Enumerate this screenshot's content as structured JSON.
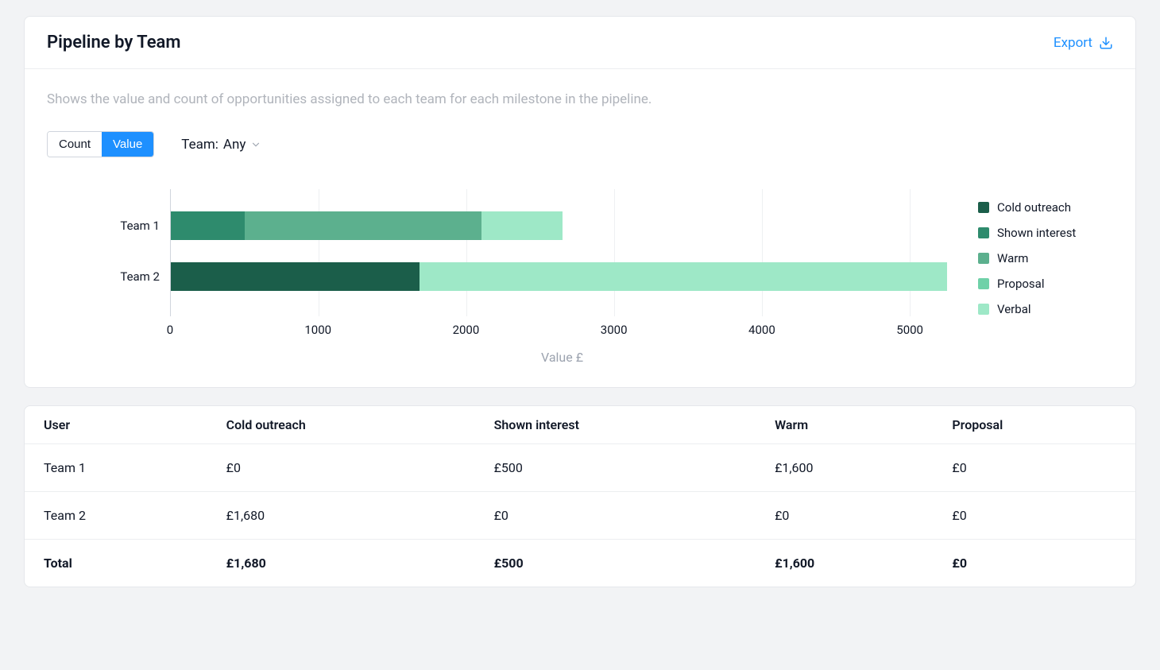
{
  "header": {
    "title": "Pipeline by Team",
    "export_label": "Export"
  },
  "description": "Shows the value and count of opportunities assigned to each team for each milestone in the pipeline.",
  "controls": {
    "toggle": {
      "count_label": "Count",
      "value_label": "Value",
      "active": "value"
    },
    "team_label": "Team:",
    "team_value": "Any"
  },
  "legend": [
    {
      "name": "Cold outreach",
      "color": "#1b5e4a"
    },
    {
      "name": "Shown interest",
      "color": "#2e8b6d"
    },
    {
      "name": "Warm",
      "color": "#5cb08e"
    },
    {
      "name": "Proposal",
      "color": "#6fd1a8"
    },
    {
      "name": "Verbal",
      "color": "#9ee8c7"
    }
  ],
  "chart_data": {
    "type": "bar",
    "orientation": "horizontal",
    "stacked": true,
    "xlabel": "Value £",
    "ylabel": "",
    "xlim": [
      0,
      5300
    ],
    "x_ticks": [
      0,
      1000,
      2000,
      3000,
      4000,
      5000
    ],
    "categories": [
      "Team 1",
      "Team 2"
    ],
    "series": [
      {
        "name": "Cold outreach",
        "color": "#1b5e4a",
        "values": [
          0,
          1680
        ]
      },
      {
        "name": "Shown interest",
        "color": "#2e8b6d",
        "values": [
          500,
          0
        ]
      },
      {
        "name": "Warm",
        "color": "#5cb08e",
        "values": [
          1600,
          0
        ]
      },
      {
        "name": "Proposal",
        "color": "#6fd1a8",
        "values": [
          0,
          0
        ]
      },
      {
        "name": "Verbal",
        "color": "#9ee8c7",
        "values": [
          550,
          3570
        ]
      }
    ]
  },
  "table": {
    "columns": [
      "User",
      "Cold outreach",
      "Shown interest",
      "Warm",
      "Proposal"
    ],
    "rows": [
      [
        "Team 1",
        "£0",
        "£500",
        "£1,600",
        "£0"
      ],
      [
        "Team 2",
        "£1,680",
        "£0",
        "£0",
        "£0"
      ],
      [
        "Total",
        "£1,680",
        "£500",
        "£1,600",
        "£0"
      ]
    ]
  }
}
